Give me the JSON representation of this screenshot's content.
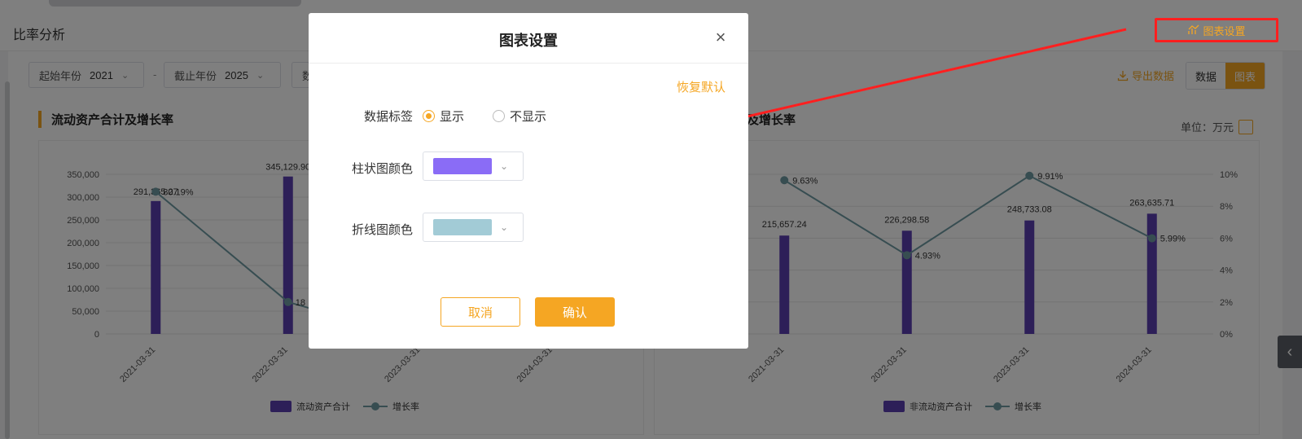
{
  "page": {
    "title": "比率分析",
    "chart_settings_link": "图表设置"
  },
  "filters": {
    "start_year_label": "起始年份",
    "start_year_value": "2021",
    "end_year_label": "截止年份",
    "end_year_value": "2025",
    "separator": "-",
    "third_label": "数"
  },
  "toolbar": {
    "export_label": "导出数据",
    "view_data_label": "数据",
    "view_chart_label": "图表"
  },
  "panels": {
    "left_title": "流动资产合计及增长率",
    "right_title": "计及增长率",
    "unit": "单位：万元"
  },
  "colors": {
    "accent": "#f5a623",
    "bar": "#5a3fb0",
    "line": "#6f9aa3",
    "annotation": "#ff1f1f"
  },
  "chart_data": [
    {
      "type": "bar",
      "categories": [
        "2021-03-31",
        "2022-03-31",
        "2023-03-31",
        "2024-03-31"
      ],
      "series": [
        {
          "name": "流动资产合计",
          "values": [
            291365.27,
            345129.9,
            null,
            null
          ]
        },
        {
          "name": "增长率",
          "type": "line",
          "values": [
            80.19,
            18,
            null,
            null
          ]
        }
      ],
      "data_labels": [
        "291,365.27",
        "345,129.9",
        "80.19%",
        "18"
      ],
      "yticks": [
        "350,000",
        "300,000",
        "250,000",
        "200,000",
        "150,000",
        "100,000",
        "50,000",
        "0"
      ],
      "ylim": [
        0,
        350000
      ]
    },
    {
      "type": "bar",
      "categories": [
        "2021-03-31",
        "2022-03-31",
        "2023-03-31",
        "2024-03-31"
      ],
      "series": [
        {
          "name": "非流动资产合计",
          "values": [
            215657.24,
            226298.58,
            248733.08,
            263635.71
          ]
        },
        {
          "name": "增长率",
          "type": "line",
          "values": [
            9.63,
            4.93,
            9.91,
            5.99
          ]
        }
      ],
      "data_labels": [
        "215,657.24",
        "226,298.58",
        "248,733.08",
        "263,635.71",
        "9.63%",
        "4.93%",
        "9.91%",
        "5.99%"
      ],
      "y2ticks": [
        "10%",
        "8%",
        "6%",
        "4%",
        "2%",
        "0%"
      ],
      "ylim": [
        0,
        350000
      ],
      "y2lim": [
        0,
        10
      ]
    }
  ],
  "modal": {
    "title": "图表设置",
    "reset_label": "恢复默认",
    "data_label_label": "数据标签",
    "show_label": "显示",
    "hide_label": "不显示",
    "bar_color_label": "柱状图颜色",
    "bar_color": "#8a6cf6",
    "line_color_label": "折线图颜色",
    "line_color": "#a2cbd6",
    "cancel_label": "取消",
    "confirm_label": "确认"
  }
}
